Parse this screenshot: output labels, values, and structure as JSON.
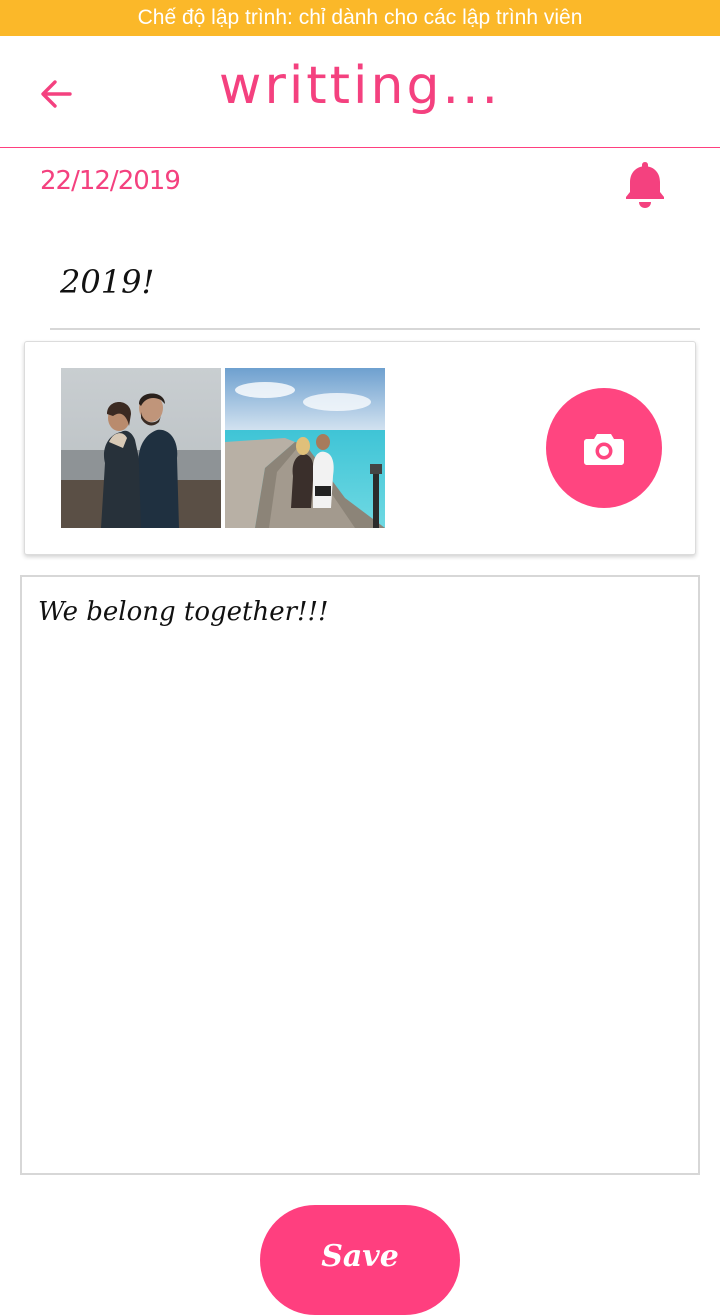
{
  "dev_banner": "Chế độ lập trình: chỉ dành cho các lập trình viên",
  "header": {
    "title": "writting..."
  },
  "entry": {
    "date": "22/12/2019",
    "title_value": "2019!",
    "content_value": "We belong together!!!"
  },
  "photos": {
    "items": [
      {
        "icon": "couple-beach-photo"
      },
      {
        "icon": "couple-boardwalk-photo"
      }
    ]
  },
  "actions": {
    "save_label": "Save"
  },
  "colors": {
    "accent": "#ff3f7f",
    "banner": "#fbb829",
    "border": "#d7d7d7"
  }
}
